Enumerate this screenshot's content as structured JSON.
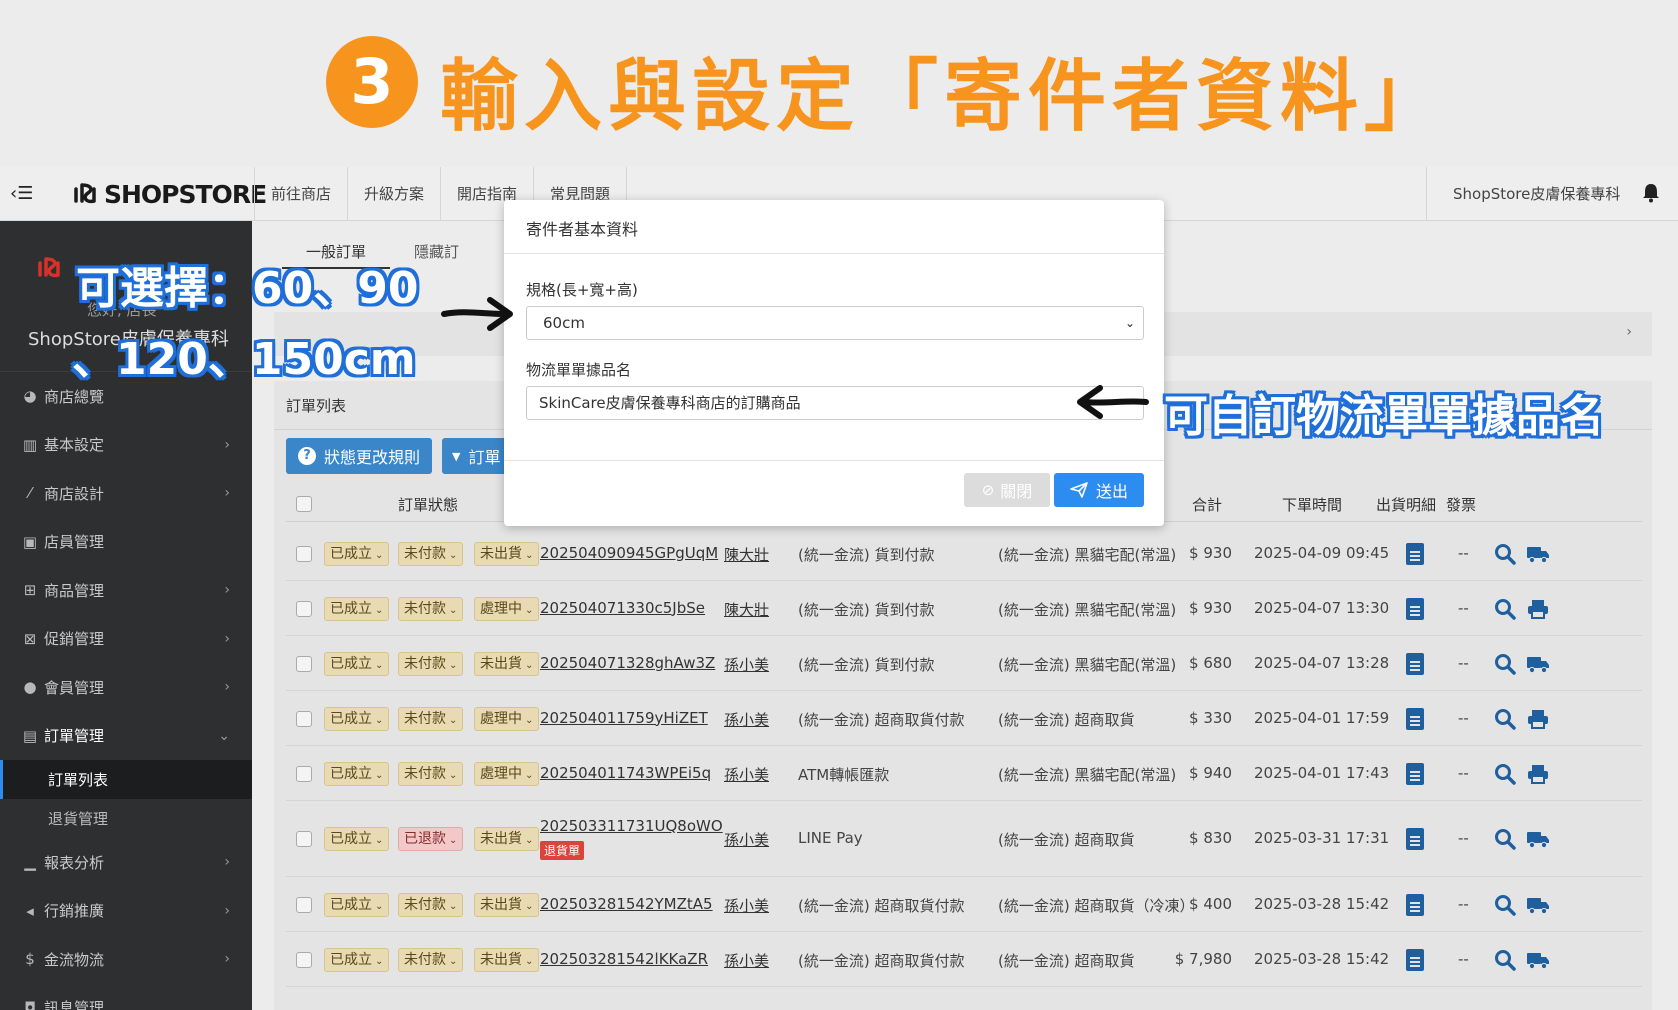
{
  "banner": {
    "number": "3",
    "title": "輸入與設定「寄件者資料」"
  },
  "topbar": {
    "logo_text": "SHOPSTORE",
    "nav_items": [
      "前往商店",
      "升級方案",
      "開店指南",
      "常見問題"
    ],
    "store_name": "ShopStore皮膚保養專科"
  },
  "sidebar": {
    "hello": "您好, 店長",
    "store": "ShopStore皮膚保養專科",
    "items": [
      {
        "label": "商店總覽",
        "icon": "dashboard-icon"
      },
      {
        "label": "基本設定",
        "icon": "bank-icon"
      },
      {
        "label": "商店設計",
        "icon": "magic-wand-icon"
      },
      {
        "label": "店員管理",
        "icon": "lock-icon"
      },
      {
        "label": "商品管理",
        "icon": "cart-icon"
      },
      {
        "label": "促銷管理",
        "icon": "gift-icon"
      },
      {
        "label": "會員管理",
        "icon": "users-icon"
      },
      {
        "label": "訂單管理",
        "icon": "orders-icon"
      }
    ],
    "sub_items": [
      "訂單列表",
      "退貨管理"
    ],
    "items_after": [
      {
        "label": "報表分析",
        "icon": "bar-chart-icon"
      },
      {
        "label": "行銷推廣",
        "icon": "megaphone-icon"
      },
      {
        "label": "金流物流",
        "icon": "dollar-icon"
      },
      {
        "label": "訊息管理",
        "icon": "message-icon"
      }
    ]
  },
  "main": {
    "tabs": [
      "一般訂單",
      "隱藏訂"
    ],
    "card_title": "訂單列表",
    "btn_rules": "狀態更改規則",
    "btn_order": "訂單",
    "headers": {
      "status": "訂單狀態",
      "total": "合計",
      "time": "下單時間",
      "ship": "出貨明細",
      "invoice": "發票"
    },
    "rows": [
      {
        "s1": "已成立",
        "s2": "未付款",
        "s3": "未出貨",
        "no": "202504090945GPgUqM",
        "cust": "陳大壯",
        "pay": "(統一金流) 貨到付款",
        "ship": "(統一金流) 黑貓宅配(常溫)",
        "total": "$ 930",
        "time": "2025-04-09 09:45",
        "inv": "--",
        "act": "truck"
      },
      {
        "s1": "已成立",
        "s2": "未付款",
        "s3": "處理中",
        "no": "202504071330c5JbSe",
        "cust": "陳大壯",
        "pay": "(統一金流) 貨到付款",
        "ship": "(統一金流) 黑貓宅配(常溫)",
        "total": "$ 930",
        "time": "2025-04-07 13:30",
        "inv": "--",
        "act": "print"
      },
      {
        "s1": "已成立",
        "s2": "未付款",
        "s3": "未出貨",
        "no": "202504071328ghAw3Z",
        "cust": "孫小美",
        "pay": "(統一金流) 貨到付款",
        "ship": "(統一金流) 黑貓宅配(常溫)",
        "total": "$ 680",
        "time": "2025-04-07 13:28",
        "inv": "--",
        "act": "truck"
      },
      {
        "s1": "已成立",
        "s2": "未付款",
        "s3": "處理中",
        "no": "202504011759yHiZET",
        "cust": "孫小美",
        "pay": "(統一金流) 超商取貨付款",
        "ship": "(統一金流) 超商取貨",
        "total": "$ 330",
        "time": "2025-04-01 17:59",
        "inv": "--",
        "act": "print"
      },
      {
        "s1": "已成立",
        "s2": "未付款",
        "s3": "處理中",
        "no": "202504011743WPEi5q",
        "cust": "孫小美",
        "pay": "ATM轉帳匯款",
        "ship": "(統一金流) 黑貓宅配(常溫)",
        "total": "$ 940",
        "time": "2025-04-01 17:43",
        "inv": "--",
        "act": "print"
      },
      {
        "s1": "已成立",
        "s2": "已退款",
        "s3": "未出貨",
        "no": "202503311731UQ8oWO",
        "badge": "退貨單",
        "cust": "孫小美",
        "pay": "LINE Pay",
        "ship": "(統一金流) 超商取貨",
        "total": "$ 830",
        "time": "2025-03-31 17:31",
        "inv": "--",
        "act": "truck"
      },
      {
        "s1": "已成立",
        "s2": "未付款",
        "s3": "未出貨",
        "no": "202503281542YMZtA5",
        "cust": "孫小美",
        "pay": "(統一金流) 超商取貨付款",
        "ship": "(統一金流) 超商取貨（冷凍）",
        "total": "$ 400",
        "time": "2025-03-28 15:42",
        "inv": "--",
        "act": "truck"
      },
      {
        "s1": "已成立",
        "s2": "未付款",
        "s3": "未出貨",
        "no": "202503281542lKKaZR",
        "cust": "孫小美",
        "pay": "(統一金流) 超商取貨付款",
        "ship": "(統一金流) 超商取貨",
        "total": "$ 7,980",
        "time": "2025-03-28 15:42",
        "inv": "--",
        "act": "truck"
      }
    ]
  },
  "modal": {
    "title": "寄件者基本資料",
    "size_label": "規格(長+寬+高)",
    "size_value": "60cm",
    "name_label": "物流單單據品名",
    "name_value": "SkinCare皮膚保養專科商店的訂購商品",
    "close_label": "關閉",
    "send_label": "送出"
  },
  "annotations": {
    "size_line1": "可選擇：60、90",
    "size_line2": "、120、150cm",
    "name_note": "可自訂物流單單據品名"
  },
  "colors": {
    "accent_orange": "#f7941d",
    "primary_blue": "#2d8cf0",
    "annotation_blue": "#1e6fd9"
  }
}
